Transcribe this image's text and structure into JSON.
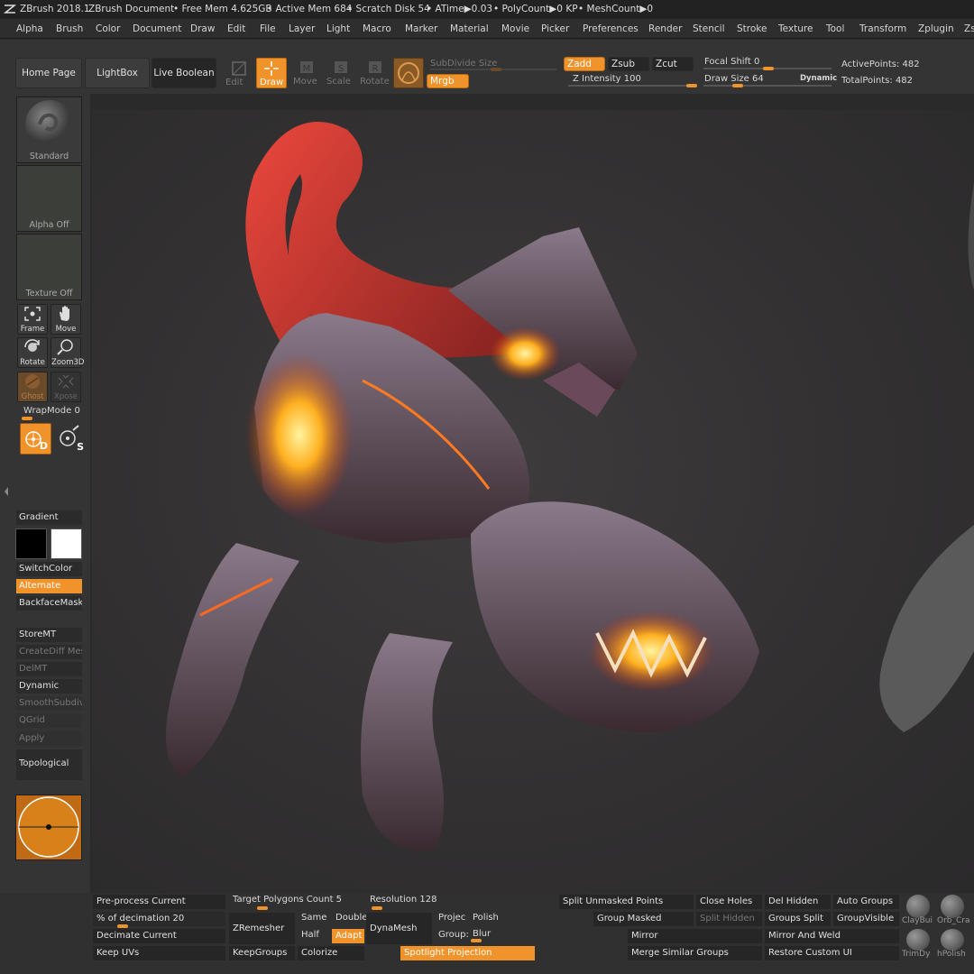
{
  "title_bar": {
    "app": "ZBrush 2018.1",
    "document": "ZBrush Document",
    "free_mem": "• Free Mem 4.625GB",
    "active_mem": "• Active Mem 684",
    "scratch": "• Scratch Disk 54",
    "atime": "• ATime▶0.03",
    "polycount": "• PolyCount▶0 KP",
    "meshcount": "• MeshCount▶0"
  },
  "menu": [
    "Alpha",
    "Brush",
    "Color",
    "Document",
    "Draw",
    "Edit",
    "File",
    "Layer",
    "Light",
    "Macro",
    "Marker",
    "Material",
    "Movie",
    "Picker",
    "Preferences",
    "Render",
    "Stencil",
    "Stroke",
    "Texture",
    "Tool",
    "Transform",
    "Zplugin",
    "Zs"
  ],
  "shelf": {
    "home_page": "Home Page",
    "lightbox": "LightBox",
    "live_boolean": "Live Boolean",
    "edit": "Edit",
    "draw": "Draw",
    "move": "Move",
    "scale": "Scale",
    "rotate": "Rotate",
    "subdivide_size": "SubDivide Size",
    "mrgb": "Mrgb",
    "zadd": "Zadd",
    "zsub": "Zsub",
    "zcut": "Zcut",
    "z_intensity": "Z Intensity 100",
    "focal_shift": "Focal Shift 0",
    "draw_size": "Draw Size 64",
    "dynamic": "Dynamic",
    "active_points": "ActivePoints: 482",
    "total_points": "TotalPoints: 482"
  },
  "left": {
    "standard": "Standard",
    "alpha_off": "Alpha Off",
    "texture_off": "Texture Off",
    "frame": "Frame",
    "move": "Move",
    "rotate": "Rotate",
    "zoom3d": "Zoom3D",
    "ghost": "Ghost",
    "xpose": "Xpose",
    "wrapmode": "WrapMode 0",
    "d_label": "D",
    "s_label": "S",
    "gradient": "Gradient",
    "switchcolor": "SwitchColor",
    "alternate": "Alternate",
    "backfacemask": "BackfaceMask",
    "storemt": "StoreMT",
    "creatediff": "CreateDiff Mes",
    "delmt": "DelMT",
    "dynamic": "Dynamic",
    "smoothsubdiv": "SmoothSubdiv",
    "qgrid": "QGrid",
    "apply": "Apply",
    "topological": "Topological"
  },
  "bottom": {
    "preprocess": "Pre-process Current",
    "decimation": "% of decimation 20",
    "decimate_current": "Decimate Current",
    "keep_uvs": "Keep UVs",
    "target_poly": "Target Polygons Count 5",
    "zremesher": "ZRemesher",
    "same": "Same",
    "double": "Double",
    "half": "Half",
    "adapt": "Adapt",
    "keepgroups": "KeepGroups",
    "colorize": "Colorize",
    "resolution": "Resolution 128",
    "dynamesh": "DynaMesh",
    "project": "Projec",
    "polish": "Polish",
    "groups": "Group:",
    "blur": "Blur",
    "spotlight": "Spotlight Projection",
    "split_unmasked": "Split Unmasked Points",
    "group_masked": "Group Masked",
    "mirror": "Mirror",
    "merge_similar": "Merge Similar Groups",
    "close_holes": "Close Holes",
    "split_hidden": "Split Hidden",
    "del_hidden": "Del Hidden",
    "groups_split": "Groups Split",
    "mirror_weld": "Mirror And Weld",
    "restore_ui": "Restore Custom UI",
    "auto_groups": "Auto Groups",
    "group_visible": "GroupVisible",
    "claybui": "ClayBui",
    "orb": "Orb_Cra",
    "trimdy": "TrimDy",
    "hpolish": "hPolish"
  },
  "colors": {
    "accent": "#f0932b",
    "panel": "#343434",
    "viewport": "#323031"
  }
}
